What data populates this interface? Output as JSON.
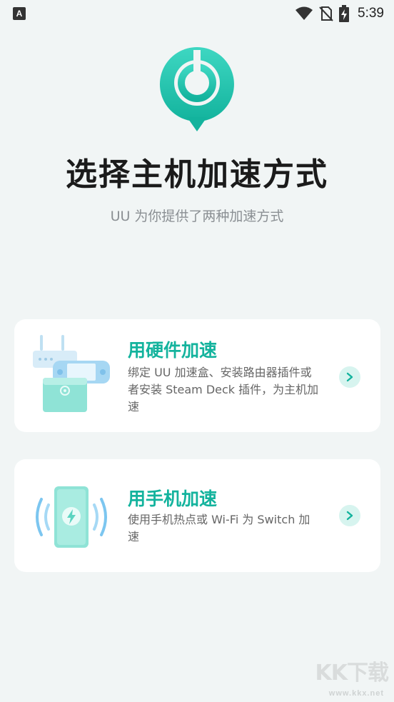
{
  "status_bar": {
    "notification_icon": "a-icon",
    "wifi_icon": "wifi-icon",
    "signal_icon": "no-sim-icon",
    "battery_icon": "battery-charging-icon",
    "time": "5:39"
  },
  "header": {
    "logo_icon": "uu-logo-icon",
    "title": "选择主机加速方式",
    "subtitle": "UU 为你提供了两种加速方式"
  },
  "options": [
    {
      "title": "用硬件加速",
      "description": "绑定 UU 加速盒、安装路由器插件或者安装 Steam Deck 插件，为主机加速",
      "illustration_icon": "hardware-devices-icon"
    },
    {
      "title": "用手机加速",
      "description": "使用手机热点或 Wi-Fi 为 Switch 加速",
      "illustration_icon": "phone-hotspot-icon"
    }
  ],
  "watermark": {
    "brand": "KK下载",
    "url": "www.kkx.net"
  },
  "colors": {
    "accent": "#13b39d",
    "background": "#f1f5f5",
    "chevron_bg": "#d7f4ef"
  }
}
